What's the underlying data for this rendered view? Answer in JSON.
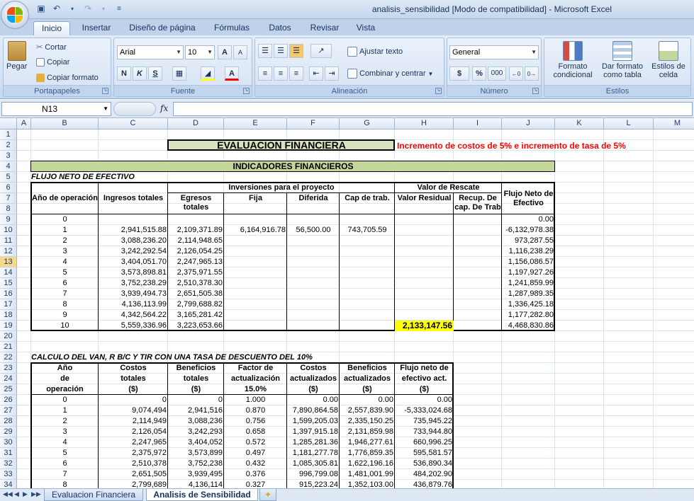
{
  "window": {
    "title": "analisis_sensibilidad  [Modo de compatibilidad] - Microsoft Excel"
  },
  "ribbon": {
    "tabs": [
      "Inicio",
      "Insertar",
      "Diseño de página",
      "Fórmulas",
      "Datos",
      "Revisar",
      "Vista"
    ],
    "active_tab": "Inicio",
    "clipboard": {
      "paste": "Pegar",
      "cut": "Cortar",
      "copy": "Copiar",
      "format_painter": "Copiar formato",
      "label": "Portapapeles"
    },
    "font": {
      "name": "Arial",
      "size": "10",
      "bold": "N",
      "italic": "K",
      "underline": "S",
      "grow": "A",
      "shrink": "A",
      "color": "A",
      "label": "Fuente"
    },
    "alignment": {
      "wrap": "Ajustar texto",
      "merge": "Combinar y centrar",
      "label": "Alineación"
    },
    "number": {
      "format": "General",
      "currency": "$",
      "percent": "%",
      "thousands": "000",
      "label": "Número"
    },
    "styles": {
      "conditional": "Formato condicional",
      "as_table": "Dar formato como tabla",
      "cell_styles": "Estilos de celda",
      "label": "Estilos"
    }
  },
  "formula_bar": {
    "name_box": "N13",
    "fx": "fx",
    "content": ""
  },
  "columns": [
    "A",
    "B",
    "C",
    "D",
    "E",
    "F",
    "G",
    "H",
    "I",
    "J",
    "K",
    "L",
    "M"
  ],
  "rows": [
    "1",
    "2",
    "3",
    "4",
    "5",
    "6",
    "7",
    "8",
    "9",
    "10",
    "11",
    "12",
    "13",
    "14",
    "15",
    "16",
    "17",
    "18",
    "19",
    "20",
    "21",
    "22",
    "23",
    "24",
    "25",
    "26",
    "27",
    "28",
    "29",
    "30",
    "31",
    "32",
    "33",
    "34"
  ],
  "selected_row": "13",
  "sheet": {
    "title": "EVALUACION FINANCIERA",
    "note": "Incremento de costos de 5% e incremento de tasa de 5%",
    "indicators": "INDICADORES FINANCIEROS",
    "flow_label": "FLUJO NETO DE EFECTIVO",
    "t1_headers": {
      "year": "Año de operación",
      "income": "Ingresos totales",
      "investments": "Inversiones para el proyecto",
      "rescue": "Valor de Rescate",
      "expenses": "Egresos totales",
      "fixed": "Fija",
      "deferred": "Diferida",
      "wc": "Cap de trab.",
      "residual": "Valor Residual",
      "recovery": "Recup. De cap. De Trab",
      "net": "Flujo Neto de Efectivo"
    },
    "t1_rows": [
      {
        "year": "0",
        "income": "",
        "expenses": "",
        "fixed": "",
        "deferred": "",
        "wc": "",
        "residual": "",
        "recovery": "",
        "net": "0.00"
      },
      {
        "year": "1",
        "income": "2,941,515.88",
        "expenses": "2,109,371.89",
        "fixed": "6,164,916.78",
        "deferred": "56,500.00",
        "wc": "743,705.59",
        "residual": "",
        "recovery": "",
        "net": "-6,132,978.38"
      },
      {
        "year": "2",
        "income": "3,088,236.20",
        "expenses": "2,114,948.65",
        "fixed": "",
        "deferred": "",
        "wc": "",
        "residual": "",
        "recovery": "",
        "net": "973,287.55"
      },
      {
        "year": "3",
        "income": "3,242,292.54",
        "expenses": "2,126,054.25",
        "fixed": "",
        "deferred": "",
        "wc": "",
        "residual": "",
        "recovery": "",
        "net": "1,116,238.29"
      },
      {
        "year": "4",
        "income": "3,404,051.70",
        "expenses": "2,247,965.13",
        "fixed": "",
        "deferred": "",
        "wc": "",
        "residual": "",
        "recovery": "",
        "net": "1,156,086.57"
      },
      {
        "year": "5",
        "income": "3,573,898.81",
        "expenses": "2,375,971.55",
        "fixed": "",
        "deferred": "",
        "wc": "",
        "residual": "",
        "recovery": "",
        "net": "1,197,927.26"
      },
      {
        "year": "6",
        "income": "3,752,238.29",
        "expenses": "2,510,378.30",
        "fixed": "",
        "deferred": "",
        "wc": "",
        "residual": "",
        "recovery": "",
        "net": "1,241,859.99"
      },
      {
        "year": "7",
        "income": "3,939,494.73",
        "expenses": "2,651,505.38",
        "fixed": "",
        "deferred": "",
        "wc": "",
        "residual": "",
        "recovery": "",
        "net": "1,287,989.35"
      },
      {
        "year": "8",
        "income": "4,136,113.99",
        "expenses": "2,799,688.82",
        "fixed": "",
        "deferred": "",
        "wc": "",
        "residual": "",
        "recovery": "",
        "net": "1,336,425.18"
      },
      {
        "year": "9",
        "income": "4,342,564.22",
        "expenses": "3,165,281.42",
        "fixed": "",
        "deferred": "",
        "wc": "",
        "residual": "",
        "recovery": "",
        "net": "1,177,282.80"
      },
      {
        "year": "10",
        "income": "5,559,336.96",
        "expenses": "3,223,653.66",
        "fixed": "",
        "deferred": "",
        "wc": "",
        "residual": "2,133,147.56",
        "recovery": "",
        "net": "4,468,830.86"
      }
    ],
    "van_label": "CALCULO DEL VAN,  R B/C Y TIR CON UNA TASA DE DESCUENTO DEL 10%",
    "t2_headers": {
      "year": [
        "Año",
        "de",
        "operación"
      ],
      "costs": [
        "Costos",
        "totales",
        "($)"
      ],
      "benefits": [
        "Beneficios",
        "totales",
        "($)"
      ],
      "factor": [
        "Factor de",
        "actualización",
        "15.0%"
      ],
      "costs_act": [
        "Costos",
        "actualizados",
        "($)"
      ],
      "benefits_act": [
        "Beneficios",
        "actualizados",
        "($)"
      ],
      "net_act": [
        "Flujo neto de",
        "efectivo act.",
        "($)"
      ]
    },
    "t2_rows": [
      {
        "year": "0",
        "costs": "0",
        "benefits": "0",
        "factor": "1.000",
        "costs_act": "0.00",
        "benefits_act": "0.00",
        "net_act": "0.00"
      },
      {
        "year": "1",
        "costs": "9,074,494",
        "benefits": "2,941,516",
        "factor": "0.870",
        "costs_act": "7,890,864.58",
        "benefits_act": "2,557,839.90",
        "net_act": "-5,333,024.68"
      },
      {
        "year": "2",
        "costs": "2,114,949",
        "benefits": "3,088,236",
        "factor": "0.756",
        "costs_act": "1,599,205.03",
        "benefits_act": "2,335,150.25",
        "net_act": "735,945.22"
      },
      {
        "year": "3",
        "costs": "2,126,054",
        "benefits": "3,242,293",
        "factor": "0.658",
        "costs_act": "1,397,915.18",
        "benefits_act": "2,131,859.98",
        "net_act": "733,944.80"
      },
      {
        "year": "4",
        "costs": "2,247,965",
        "benefits": "3,404,052",
        "factor": "0.572",
        "costs_act": "1,285,281.36",
        "benefits_act": "1,946,277.61",
        "net_act": "660,996.25"
      },
      {
        "year": "5",
        "costs": "2,375,972",
        "benefits": "3,573,899",
        "factor": "0.497",
        "costs_act": "1,181,277.78",
        "benefits_act": "1,776,859.35",
        "net_act": "595,581.57"
      },
      {
        "year": "6",
        "costs": "2,510,378",
        "benefits": "3,752,238",
        "factor": "0.432",
        "costs_act": "1,085,305.81",
        "benefits_act": "1,622,196.16",
        "net_act": "536,890.34"
      },
      {
        "year": "7",
        "costs": "2,651,505",
        "benefits": "3,939,495",
        "factor": "0.376",
        "costs_act": "996,799.08",
        "benefits_act": "1,481,001.99",
        "net_act": "484,202.90"
      },
      {
        "year": "8",
        "costs": "2,799,689",
        "benefits": "4,136,114",
        "factor": "0.327",
        "costs_act": "915,223.24",
        "benefits_act": "1,352,103.00",
        "net_act": "436,879.76"
      }
    ]
  },
  "sheet_tabs": [
    "Evaluacion Financiera",
    "Analisis de Sensibilidad"
  ],
  "active_sheet": "Analisis de Sensibilidad",
  "colors": {
    "title_bg": "#d6e3bc",
    "header_bg": "#c4d79b",
    "highlight": "#ffff00",
    "note_red": "#ff0000"
  }
}
